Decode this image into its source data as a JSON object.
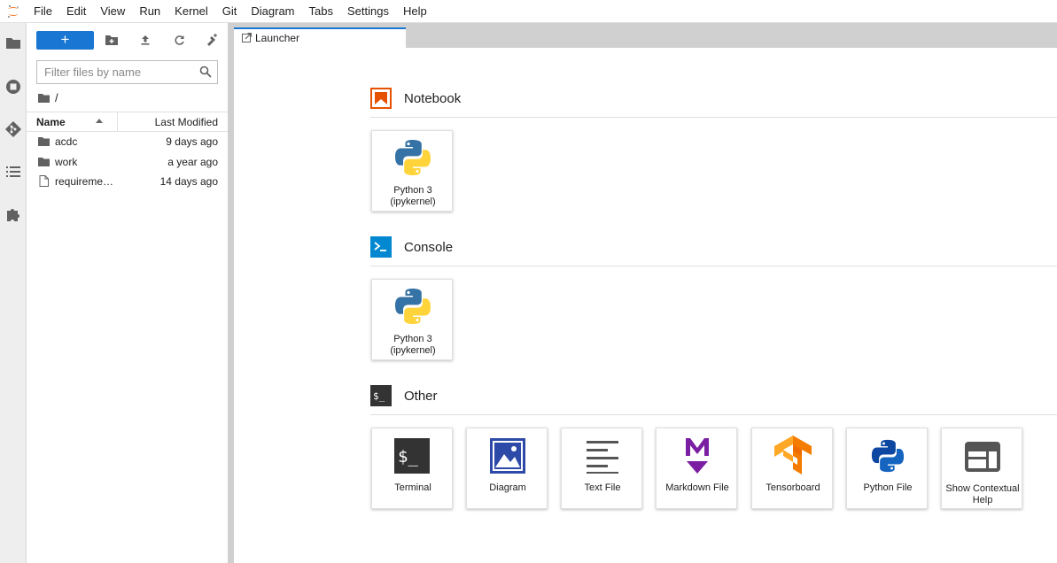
{
  "menubar": {
    "items": [
      "File",
      "Edit",
      "View",
      "Run",
      "Kernel",
      "Git",
      "Diagram",
      "Tabs",
      "Settings",
      "Help"
    ]
  },
  "filebrowser": {
    "new_button_label": "+",
    "filter_placeholder": "Filter files by name",
    "breadcrumb": "/",
    "header_name": "Name",
    "header_modified": "Last Modified",
    "files": [
      {
        "name": "acdc",
        "modified": "9 days ago",
        "type": "folder"
      },
      {
        "name": "work",
        "modified": "a year ago",
        "type": "folder"
      },
      {
        "name": "requirements.txt",
        "modified": "14 days ago",
        "type": "file"
      }
    ]
  },
  "tabs": [
    {
      "label": "Launcher",
      "active": true
    }
  ],
  "launcher": {
    "sections": [
      {
        "title": "Notebook",
        "cards": [
          {
            "label": "Python 3\n(ipykernel)",
            "icon": "python-icon"
          }
        ]
      },
      {
        "title": "Console",
        "cards": [
          {
            "label": "Python 3\n(ipykernel)",
            "icon": "python-icon"
          }
        ]
      },
      {
        "title": "Other",
        "cards": [
          {
            "label": "Terminal",
            "icon": "terminal-icon"
          },
          {
            "label": "Diagram",
            "icon": "diagram-icon"
          },
          {
            "label": "Text File",
            "icon": "text-file-icon"
          },
          {
            "label": "Markdown File",
            "icon": "markdown-icon"
          },
          {
            "label": "Tensorboard",
            "icon": "tensorflow-icon"
          },
          {
            "label": "Python File",
            "icon": "python-file-icon"
          },
          {
            "label": "Show Contextual\nHelp",
            "icon": "contextual-help-icon"
          }
        ]
      }
    ]
  },
  "colors": {
    "accent": "#1976d2",
    "notebook": "#e65100",
    "console": "#0288d1",
    "other": "#333333",
    "markdown": "#7b1fa2",
    "tensorflow": "#f57c00",
    "diagram": "#2d4aa8"
  }
}
